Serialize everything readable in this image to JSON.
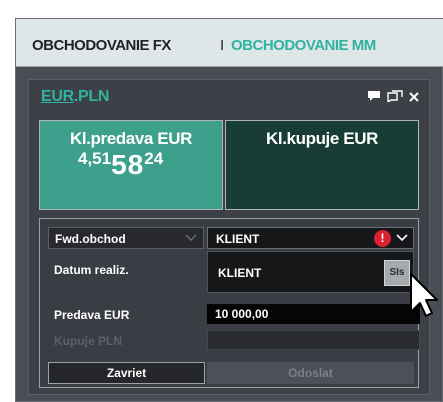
{
  "tabs": {
    "active": "OBCHODOVANIE FX",
    "separator": "I",
    "inactive": "OBCHODOVANIE MM"
  },
  "pair": {
    "base": "EUR",
    "dot": ".",
    "quote": "PLN"
  },
  "panel_icons": [
    "chat-icon",
    "popout-icon",
    "close-icon"
  ],
  "quotes": {
    "sell": {
      "label": "Kl.predava EUR",
      "price_small": "4,51",
      "price_big": "58",
      "price_pip": "24"
    },
    "buy": {
      "label": "Kl.kupuje EUR"
    }
  },
  "form": {
    "type_select": "Fwd.obchod",
    "client_select": "KLIENT",
    "client_warning": "!",
    "dropdown_item": "KLIENT",
    "dropdown_button": "SIs",
    "fields": {
      "datum_label": "Datum realiz.",
      "sell_label": "Predava EUR",
      "sell_value": "10 000,00",
      "buy_label": "Kupuje PLN"
    },
    "close_button": "Zavriet",
    "send_button": "Odoslat"
  },
  "colors": {
    "accent_teal": "#2fb3a0",
    "sell_bg": "#3da08c",
    "buy_bg": "#173d34",
    "warning": "#d9212f"
  }
}
